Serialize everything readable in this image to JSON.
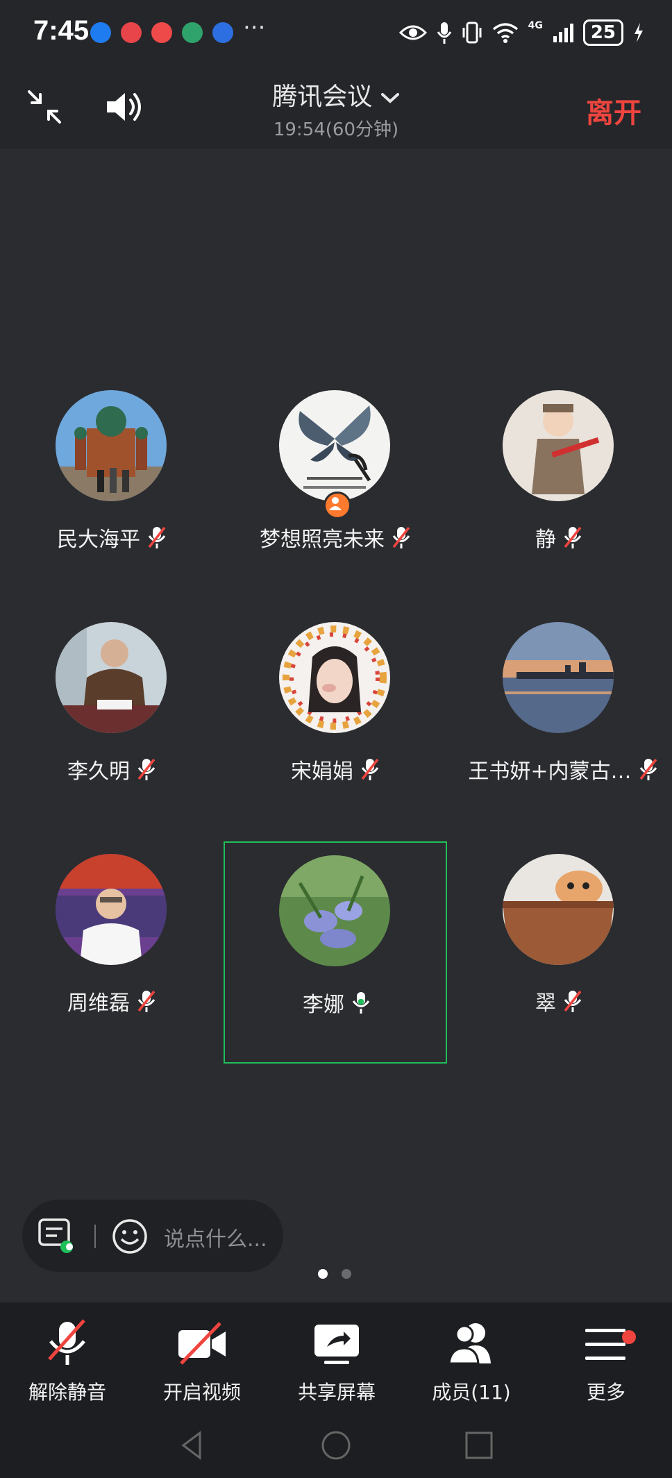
{
  "status_bar": {
    "time": "7:45",
    "more": "···",
    "battery": "25",
    "network": "4G"
  },
  "header": {
    "title": "腾讯会议",
    "duration": "19:54(60分钟)",
    "leave_label": "离开"
  },
  "participants": [
    {
      "name": "民大海平",
      "muted": true,
      "avatar": "cathedral-photo"
    },
    {
      "name": "梦想照亮未来",
      "muted": true,
      "host": true,
      "avatar": "butterfly-calligraphy"
    },
    {
      "name": "静",
      "muted": true,
      "avatar": "child-costume-photo"
    },
    {
      "name": "李久明",
      "muted": true,
      "avatar": "man-at-desk-photo"
    },
    {
      "name": "宋娟娟",
      "muted": true,
      "avatar": "girl-fruit-frame-photo"
    },
    {
      "name": "王书妍+内蒙古…",
      "muted": true,
      "avatar": "lake-sunset-photo"
    },
    {
      "name": "周维磊",
      "muted": true,
      "avatar": "man-stage-photo"
    },
    {
      "name": "李娜",
      "muted": false,
      "active": true,
      "avatar": "blue-flowers-photo"
    },
    {
      "name": "翠",
      "muted": true,
      "avatar": "cat-in-basket-photo"
    }
  ],
  "chat": {
    "placeholder": "说点什么..."
  },
  "pager": {
    "page": 1,
    "total": 2
  },
  "toolbar": {
    "unmute": "解除静音",
    "video": "开启视频",
    "share": "共享屏幕",
    "members": "成员(11)",
    "more": "更多"
  },
  "colors": {
    "leave": "#f0453f",
    "active_border": "#1fbf5a",
    "mic_on": "#ffffff",
    "mic_muted_slash": "#f0453f"
  }
}
